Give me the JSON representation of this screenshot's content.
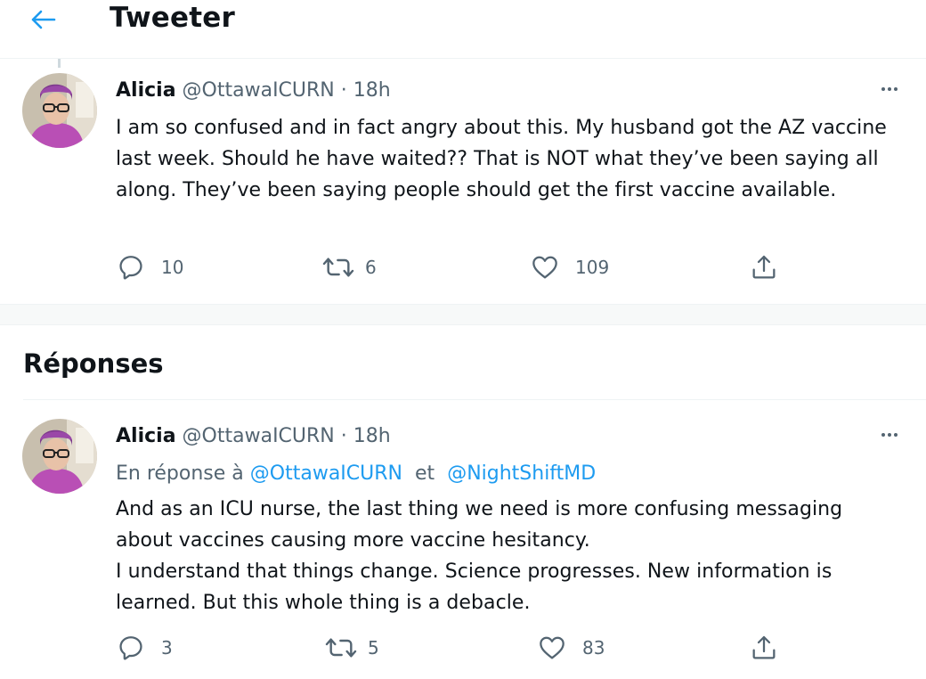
{
  "header": {
    "title": "Tweeter",
    "back_icon": "arrow-left-icon"
  },
  "main_tweet": {
    "author_name": "Alicia",
    "handle": "@OttawaICURN",
    "separator": "·",
    "time": "18h",
    "text": "I am so confused and in fact angry about this. My husband got the AZ vaccine last week. Should he have waited?? That is NOT what they’ve been saying all along. They’ve been saying people should get the first vaccine available.",
    "replies": "10",
    "retweets": "6",
    "likes": "109"
  },
  "replies_section": {
    "title": "Réponses"
  },
  "reply_tweet": {
    "author_name": "Alicia",
    "handle": "@OttawaICURN",
    "separator": "·",
    "time": "18h",
    "reply_prefix": "En réponse à",
    "reply_mention_1": "@OttawaICURN",
    "reply_conjunction": "et",
    "reply_mention_2": "@NightShiftMD",
    "text_line_1": "And as an ICU nurse, the last thing we need is more confusing messaging about vaccines causing more vaccine hesitancy.",
    "text_line_2": "I understand that things change. Science progresses. New information is learned. But this whole thing is a debacle.",
    "replies": "3",
    "retweets": "5",
    "likes": "83"
  },
  "colors": {
    "accent": "#1d9bf0",
    "text": "#0f1419",
    "muted": "#536471",
    "border": "#eff3f4"
  }
}
